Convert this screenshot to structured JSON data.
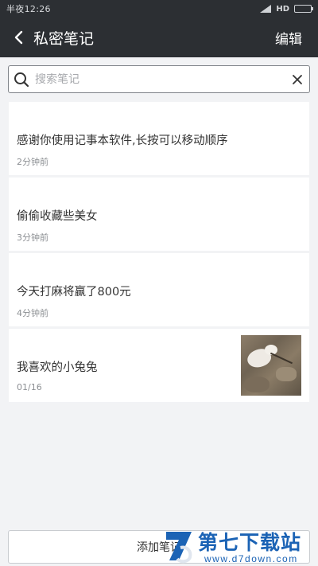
{
  "status_bar": {
    "time": "半夜12:26",
    "network": "HD",
    "icons": [
      "signal-icon",
      "battery-icon"
    ]
  },
  "header": {
    "title": "私密笔记",
    "edit_label": "编辑",
    "icons": [
      "back-icon"
    ]
  },
  "search": {
    "placeholder": "搜索笔记",
    "value": "",
    "icons": [
      "search-icon",
      "clear-icon"
    ]
  },
  "notes": [
    {
      "title": "感谢你使用记事本软件,长按可以移动顺序",
      "time": "2分钟前",
      "has_image": false
    },
    {
      "title": "偷偷收藏些美女",
      "time": "3分钟前",
      "has_image": false
    },
    {
      "title": "今天打麻将赢了800元",
      "time": "4分钟前",
      "has_image": false
    },
    {
      "title": "我喜欢的小兔兔",
      "time": "01/16",
      "has_image": true
    }
  ],
  "bottom": {
    "add_label": "添加笔记"
  },
  "watermark": {
    "title": "第七下载站",
    "url": "www.d7down.com"
  },
  "colors": {
    "header_bg": "#2c2f33",
    "page_bg": "#f2f3f5",
    "card_bg": "#ffffff",
    "time_text": "#8c8f93",
    "watermark": "#1b63b5"
  }
}
